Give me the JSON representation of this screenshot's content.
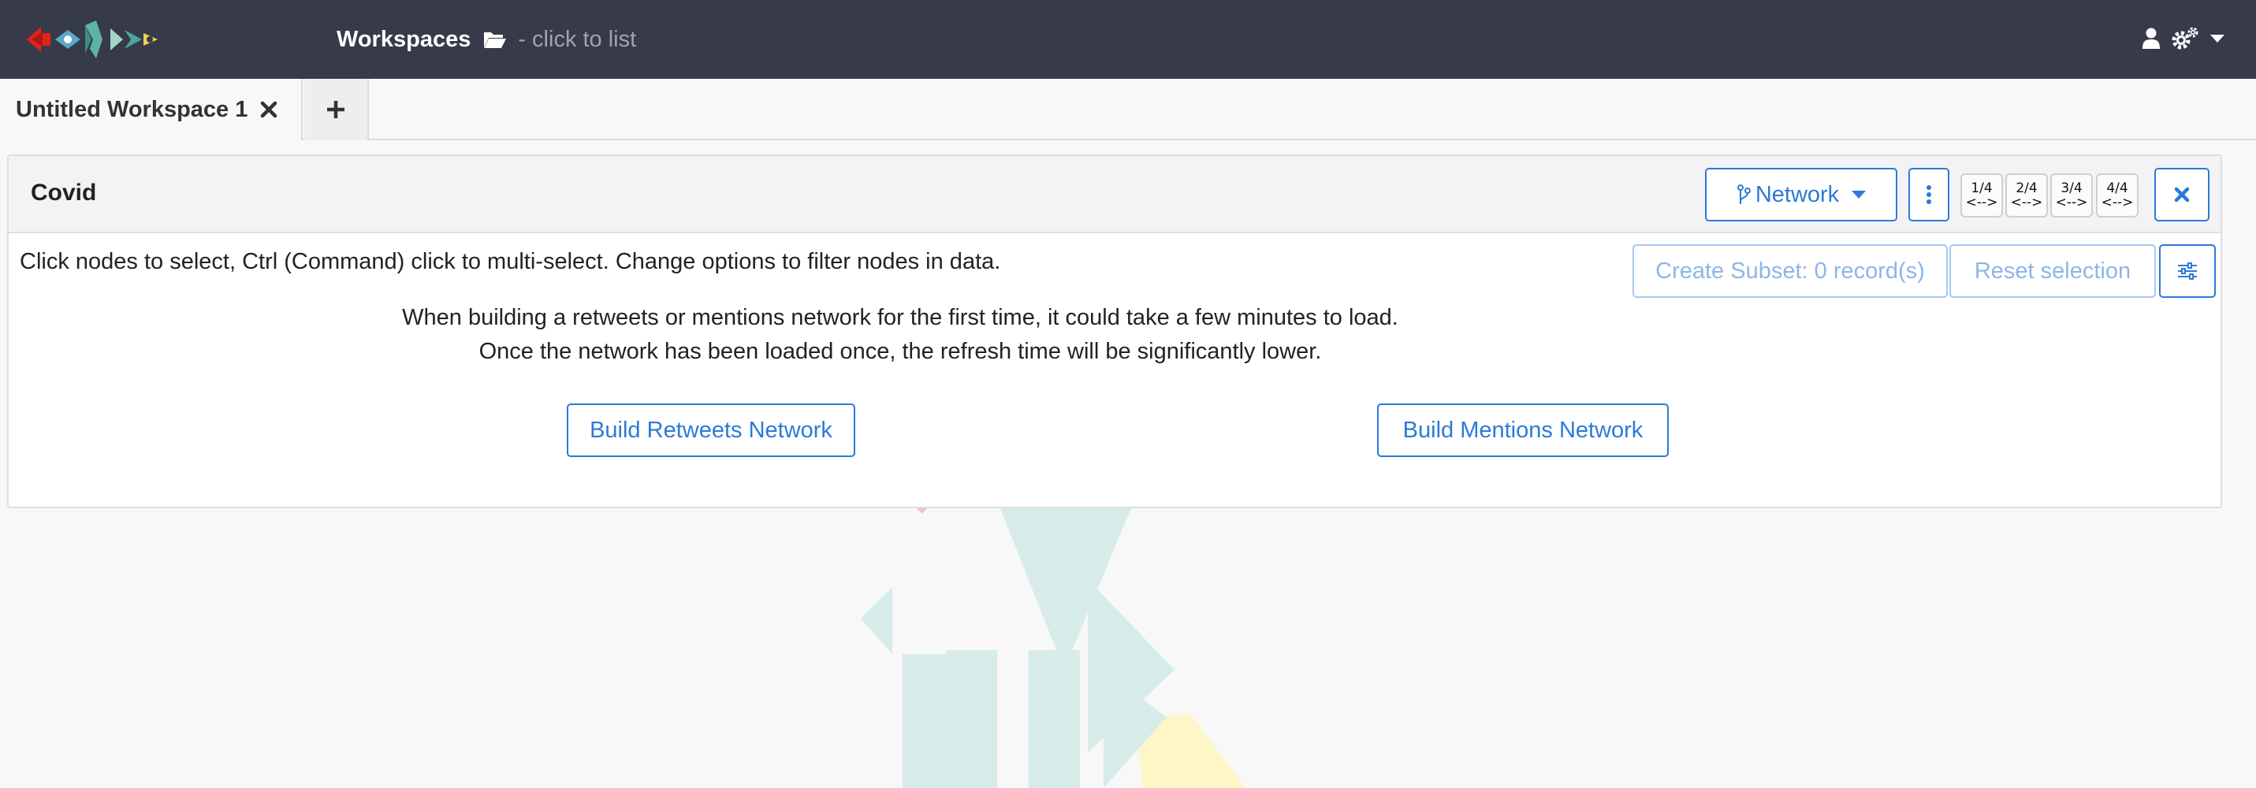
{
  "navbar": {
    "workspaces_label": "Workspaces",
    "workspaces_hint": "- click to list",
    "icons": [
      "app-logo",
      "folder-open-icon",
      "user-icon",
      "settings-icon",
      "caret-down-icon"
    ]
  },
  "tabs": [
    {
      "label": "Untitled Workspace 1"
    }
  ],
  "panel": {
    "title": "Covid",
    "view_selector": "Network",
    "layout_buttons": [
      {
        "top": "1/4",
        "bottom": "<-->"
      },
      {
        "top": "2/4",
        "bottom": "<-->"
      },
      {
        "top": "3/4",
        "bottom": "<-->"
      },
      {
        "top": "4/4",
        "bottom": "<-->"
      }
    ],
    "instructions": "Click nodes to select, Ctrl (Command) click to multi-select. Change options to filter nodes in data.",
    "create_subset_label": "Create Subset: 0 record(s)",
    "reset_selection_label": "Reset selection",
    "notice_line1": "When building a retweets or mentions network for the first time, it could take a few minutes to load.",
    "notice_line2": "Once the network has been loaded once, the refresh time will be significantly lower.",
    "build_retweets_label": "Build Retweets Network",
    "build_mentions_label": "Build Mentions Network"
  },
  "colors": {
    "navbar_bg": "#363a49",
    "accent": "#2b7ad9",
    "accent_disabled": "#8eb6e6"
  }
}
